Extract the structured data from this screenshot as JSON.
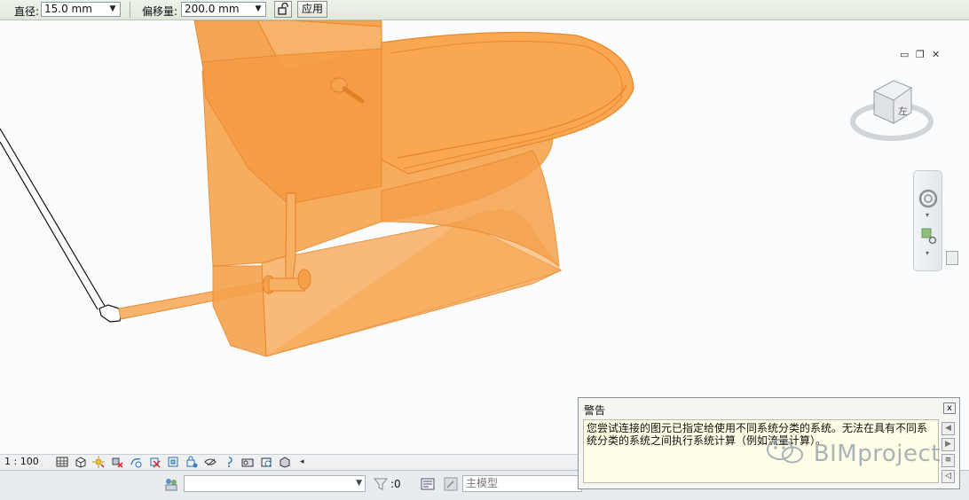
{
  "options_bar": {
    "diameter_label": "直径:",
    "diameter_value": "15.0 mm",
    "offset_label": "偏移量:",
    "offset_value": "200.0 mm",
    "apply_label": "应用"
  },
  "view_controls": {
    "scale": "1 : 100"
  },
  "viewcube": {
    "face_label": "左"
  },
  "status_bar": {
    "selection_count": ":0",
    "model_placeholder": "主模型"
  },
  "warning": {
    "title": "警告",
    "close_glyph": "x",
    "message": "您尝试连接的图元已指定给使用不同系统分类的系统。无法在具有不同系统分类的系统之间执行系统计算（例如流量计算）。"
  },
  "watermark": {
    "text": "BIMproject"
  },
  "colors": {
    "model_orange": "#f7a54e",
    "model_edge": "#e8872a",
    "warning_bg": "#fefee6"
  }
}
